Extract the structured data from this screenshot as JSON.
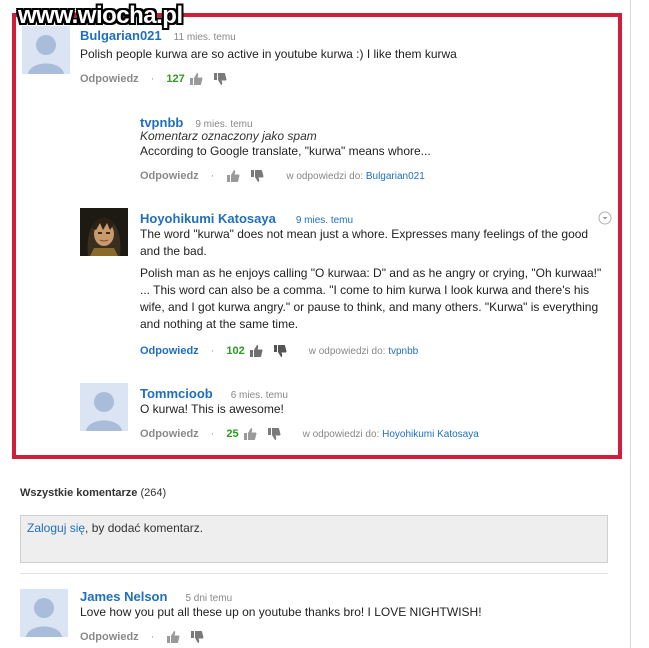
{
  "watermark": "www.wiocha.pl",
  "comments": [
    {
      "author": "Bulgarian021",
      "time": "11 mies. temu",
      "text": "Polish people kurwa are so active in youtube kurwa :) I like them kurwa",
      "reply_label": "Odpowiedz",
      "score": "127"
    },
    {
      "author": "tvpnbb",
      "time": "9 mies. temu",
      "spam_note": "Komentarz oznaczony jako spam",
      "text": "According to Google translate, \"kurwa\" means whore...",
      "reply_label": "Odpowiedz",
      "in_reply_prefix": "w odpowiedzi do:",
      "in_reply_to": "Bulgarian021"
    },
    {
      "author": "Hoyohikumi Katosaya",
      "time": "9 mies. temu",
      "text_p1": "The word \"kurwa\" does not mean just a whore. Expresses many feelings of the good and the bad.",
      "text_p2": "Polish man as he enjoys calling \"O kurwaa: D\" and as he angry or crying, \"Oh kurwaa!\" ... This word can also be a comma. \"I come to him kurwa I look kurwa and there's his wife, and I got kurwa angry.\" or pause to think, and many others. \"Kurwa\" is everything and nothing at the same time.",
      "reply_label": "Odpowiedz",
      "score": "102",
      "in_reply_prefix": "w odpowiedzi do:",
      "in_reply_to": "tvpnbb"
    },
    {
      "author": "Tommcioob",
      "time": "6 mies. temu",
      "text": "O kurwa! This is awesome!",
      "reply_label": "Odpowiedz",
      "score": "25",
      "in_reply_prefix": "w odpowiedzi do:",
      "in_reply_to": "Hoyohikumi Katosaya"
    }
  ],
  "all_comments": {
    "label": "Wszystkie komentarze",
    "count": "(264)"
  },
  "login_prompt": {
    "link": "Zaloguj się",
    "rest": ", by dodać komentarz."
  },
  "bottom_comment": {
    "author": "James Nelson",
    "time": "5 dni temu",
    "text": "Love how you put all these up on youtube thanks bro! I LOVE NIGHTWISH!",
    "reply_label": "Odpowiedz"
  },
  "separator": "·",
  "colors": {
    "highlight_border": "#d01e3a",
    "link": "#1f6fc0",
    "score": "#2a9d1e"
  },
  "icons": {
    "like": "thumbs-up-icon",
    "dislike": "thumbs-down-icon",
    "menu": "chevron-down-circle-icon"
  }
}
